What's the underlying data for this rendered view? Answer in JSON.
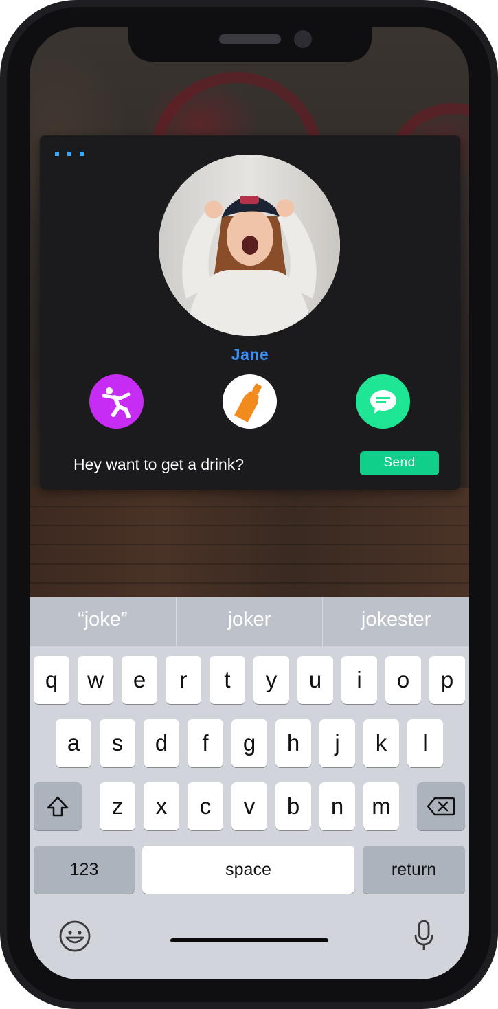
{
  "profile": {
    "name": "Jane",
    "message": "Hey want to get a drink?",
    "send_label": "Send"
  },
  "actions": [
    {
      "name": "dance",
      "icon": "dancer-icon",
      "color": "#c72cf5"
    },
    {
      "name": "drink",
      "icon": "bottle-icon",
      "color": "#ffffff"
    },
    {
      "name": "chat",
      "icon": "chat-bubble-icon",
      "color": "#1ee695"
    }
  ],
  "keyboard": {
    "suggestions": [
      "“joke”",
      "joker",
      "jokester"
    ],
    "row1": [
      "q",
      "w",
      "e",
      "r",
      "t",
      "y",
      "u",
      "i",
      "o",
      "p"
    ],
    "row2": [
      "a",
      "s",
      "d",
      "f",
      "g",
      "h",
      "j",
      "k",
      "l"
    ],
    "row3": [
      "z",
      "x",
      "c",
      "v",
      "b",
      "n",
      "m"
    ],
    "numbers_label": "123",
    "space_label": "space",
    "return_label": "return"
  },
  "colors": {
    "accent_blue": "#3a8ff0",
    "send_green": "#0fcf8b",
    "card_bg": "#1b1b1d"
  }
}
